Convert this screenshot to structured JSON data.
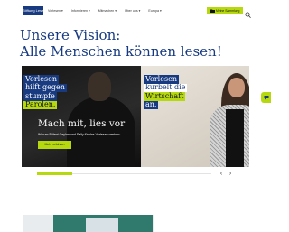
{
  "header": {
    "logo_text": "Stiftung Lesen",
    "nav": [
      {
        "label": "Vorlesen"
      },
      {
        "label": "Informieren"
      },
      {
        "label": "Mitmachen"
      },
      {
        "label": "Über uns"
      },
      {
        "label": "Europa"
      }
    ],
    "cta_label": "Meine Sammlung"
  },
  "main": {
    "headline": "Unsere Vision:\nAlle Menschen können lesen!"
  },
  "hero": {
    "quote_left": [
      "Vorlesen",
      "hilft gegen",
      "stumpfe",
      "Parolen."
    ],
    "quote_right": [
      "Vorlesen",
      "kurbelt die",
      "Wirtschaft",
      "an."
    ],
    "title": "Mach mit, lies vor",
    "subtitle": "Warum Bülent Ceylan und Sally für das Vorlesen werben:",
    "button_label": "Mehr erfahren",
    "progress_fraction": 0.2
  },
  "colors": {
    "brand_blue": "#173a80",
    "accent_green": "#b6d80f"
  }
}
